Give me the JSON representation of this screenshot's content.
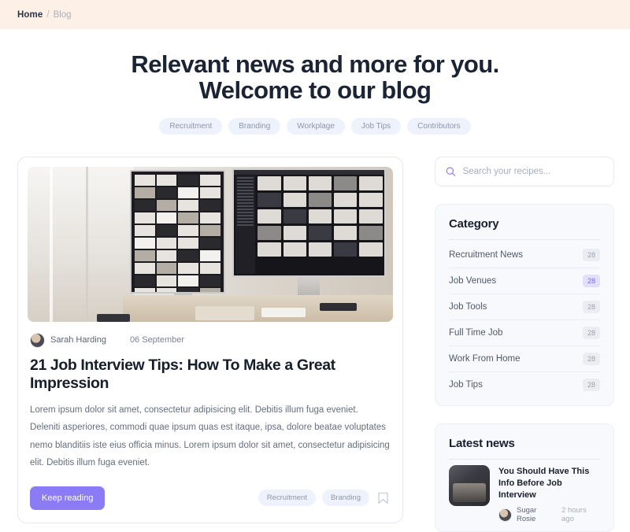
{
  "breadcrumb": {
    "home": "Home",
    "separator": "/",
    "current": "Blog"
  },
  "hero": {
    "title_line1": "Relevant news and more for you.",
    "title_line2": "Welcome to our blog",
    "tags": [
      "Recruitment",
      "Branding",
      "Workplage",
      "Job Tips",
      "Contributors"
    ]
  },
  "article": {
    "author": "Sarah Harding",
    "date": "06 September",
    "title": "21 Job Interview Tips: How To Make a Great Impression",
    "body": "Lorem ipsum dolor sit amet, consectetur adipisicing elit. Debitis illum fuga eveniet. Deleniti asperiores, commodi quae ipsum quas est itaque, ipsa, dolore beatae voluptates nemo blanditiis iste eius officia minus. Lorem ipsum dolor sit amet, consectetur adipisicing elit. Debitis illum fuga eveniet.",
    "keep_reading_label": "Keep reading",
    "tags": [
      "Recruitment",
      "Branding"
    ]
  },
  "search": {
    "placeholder": "Search your recipes...",
    "value": ""
  },
  "category": {
    "title": "Category",
    "items": [
      {
        "label": "Recruitment News",
        "count": "28",
        "active": false
      },
      {
        "label": "Job Venues",
        "count": "28",
        "active": true
      },
      {
        "label": "Job Tools",
        "count": "28",
        "active": false
      },
      {
        "label": "Full Time Job",
        "count": "28",
        "active": false
      },
      {
        "label": "Work From Home",
        "count": "28",
        "active": false
      },
      {
        "label": "Job Tips",
        "count": "28",
        "active": false
      }
    ]
  },
  "latest_news": {
    "title": "Latest news",
    "items": [
      {
        "title": "You Should Have This Info Before Job Interview",
        "author": "Sugar Rosie",
        "time": "2 hours ago"
      }
    ]
  },
  "colors": {
    "accent": "#8b7cf6",
    "breadcrumb_bg": "#fdf1e7",
    "pill_bg": "#eef2fd",
    "panel_bg": "#f8f9fd"
  }
}
